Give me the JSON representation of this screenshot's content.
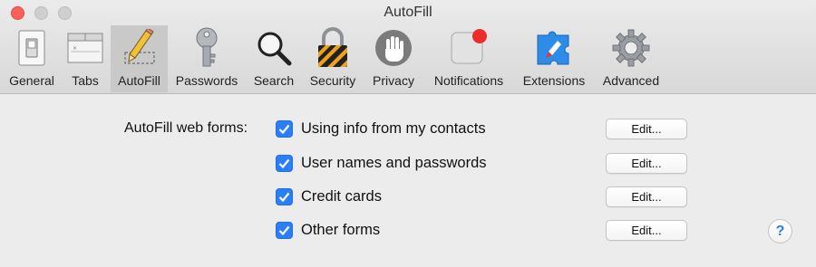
{
  "window": {
    "title": "AutoFill"
  },
  "toolbar": {
    "items": [
      {
        "label": "General",
        "icon": "general-switch-icon"
      },
      {
        "label": "Tabs",
        "icon": "tabs-icon"
      },
      {
        "label": "AutoFill",
        "icon": "pencil-form-icon",
        "selected": true
      },
      {
        "label": "Passwords",
        "icon": "key-icon"
      },
      {
        "label": "Search",
        "icon": "magnifier-icon"
      },
      {
        "label": "Security",
        "icon": "padlock-icon"
      },
      {
        "label": "Privacy",
        "icon": "hand-icon"
      },
      {
        "label": "Notifications",
        "icon": "notification-badge-icon"
      },
      {
        "label": "Extensions",
        "icon": "puzzle-compass-icon"
      },
      {
        "label": "Advanced",
        "icon": "gear-icon"
      }
    ]
  },
  "autofill": {
    "section_label": "AutoFill web forms:",
    "options": [
      {
        "label": "Using info from my contacts",
        "checked": true,
        "button": "Edit..."
      },
      {
        "label": "User names and passwords",
        "checked": true,
        "button": "Edit..."
      },
      {
        "label": "Credit cards",
        "checked": true,
        "button": "Edit..."
      },
      {
        "label": "Other forms",
        "checked": true,
        "button": "Edit..."
      }
    ]
  },
  "help": {
    "label": "?"
  },
  "colors": {
    "accent": "#2a7ef7",
    "close": "#fc605b",
    "selected_tab": "#c9c9c9"
  }
}
